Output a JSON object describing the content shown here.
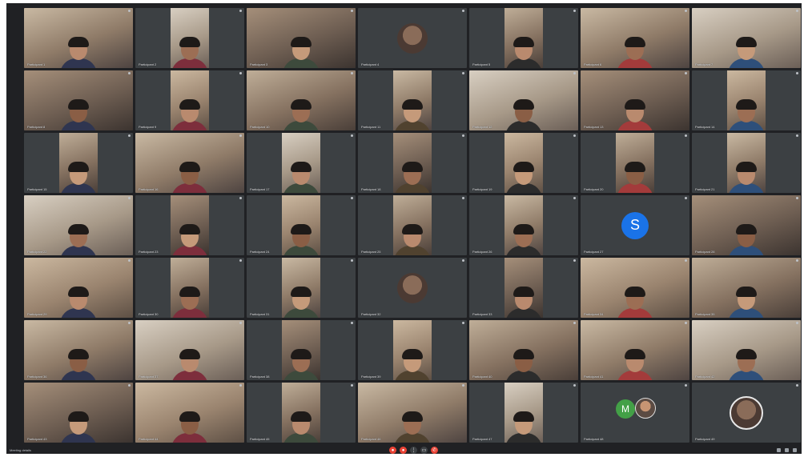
{
  "meeting": {
    "code": "Meeting details",
    "controls": [
      "mic",
      "camera",
      "end-call",
      "more",
      "present"
    ],
    "accent": "#1a73e8",
    "danger": "#ea4335"
  },
  "participants": [
    {
      "name": "Participant 1",
      "type": "video"
    },
    {
      "name": "Participant 2",
      "type": "video-narrow"
    },
    {
      "name": "Participant 3",
      "type": "video"
    },
    {
      "name": "Participant 4",
      "type": "avatar-photo"
    },
    {
      "name": "Participant 5",
      "type": "video-narrow"
    },
    {
      "name": "Participant 6",
      "type": "video"
    },
    {
      "name": "Participant 7",
      "type": "video"
    },
    {
      "name": "Participant 8",
      "type": "video"
    },
    {
      "name": "Participant 9",
      "type": "video-narrow"
    },
    {
      "name": "Participant 10",
      "type": "video"
    },
    {
      "name": "Participant 11",
      "type": "video-narrow"
    },
    {
      "name": "Participant 12",
      "type": "video"
    },
    {
      "name": "Participant 13",
      "type": "video"
    },
    {
      "name": "Participant 14",
      "type": "video-narrow"
    },
    {
      "name": "Participant 15",
      "type": "video-narrow"
    },
    {
      "name": "Participant 16",
      "type": "video"
    },
    {
      "name": "Participant 17",
      "type": "video-narrow"
    },
    {
      "name": "Participant 18",
      "type": "video-narrow"
    },
    {
      "name": "Participant 19",
      "type": "video-narrow"
    },
    {
      "name": "Participant 20",
      "type": "video-narrow"
    },
    {
      "name": "Participant 21",
      "type": "video-narrow"
    },
    {
      "name": "Participant 22",
      "type": "video"
    },
    {
      "name": "Participant 23",
      "type": "video-narrow"
    },
    {
      "name": "Participant 24",
      "type": "video-narrow"
    },
    {
      "name": "Participant 25",
      "type": "video-narrow"
    },
    {
      "name": "Participant 26",
      "type": "video-narrow"
    },
    {
      "name": "Participant 27",
      "type": "avatar-letter",
      "letter": "S"
    },
    {
      "name": "Participant 28",
      "type": "video"
    },
    {
      "name": "Participant 29",
      "type": "video"
    },
    {
      "name": "Participant 30",
      "type": "video-narrow"
    },
    {
      "name": "Participant 31",
      "type": "video-narrow"
    },
    {
      "name": "Participant 32",
      "type": "avatar-photo"
    },
    {
      "name": "Participant 33",
      "type": "video-narrow"
    },
    {
      "name": "Participant 34",
      "type": "video"
    },
    {
      "name": "Participant 35",
      "type": "video"
    },
    {
      "name": "Participant 36",
      "type": "video"
    },
    {
      "name": "Participant 37",
      "type": "video"
    },
    {
      "name": "Participant 38",
      "type": "video-narrow"
    },
    {
      "name": "Participant 39",
      "type": "video-narrow"
    },
    {
      "name": "Participant 40",
      "type": "video"
    },
    {
      "name": "Participant 41",
      "type": "video"
    },
    {
      "name": "Participant 42",
      "type": "video"
    },
    {
      "name": "Participant 43",
      "type": "video"
    },
    {
      "name": "Participant 44",
      "type": "video"
    },
    {
      "name": "Participant 45",
      "type": "video-narrow"
    },
    {
      "name": "Participant 46",
      "type": "video"
    },
    {
      "name": "Participant 47",
      "type": "video-narrow"
    },
    {
      "name": "Participant 48",
      "type": "avatar-pair",
      "letter": "M"
    },
    {
      "name": "Participant 49",
      "type": "avatar-photo-ring"
    }
  ]
}
